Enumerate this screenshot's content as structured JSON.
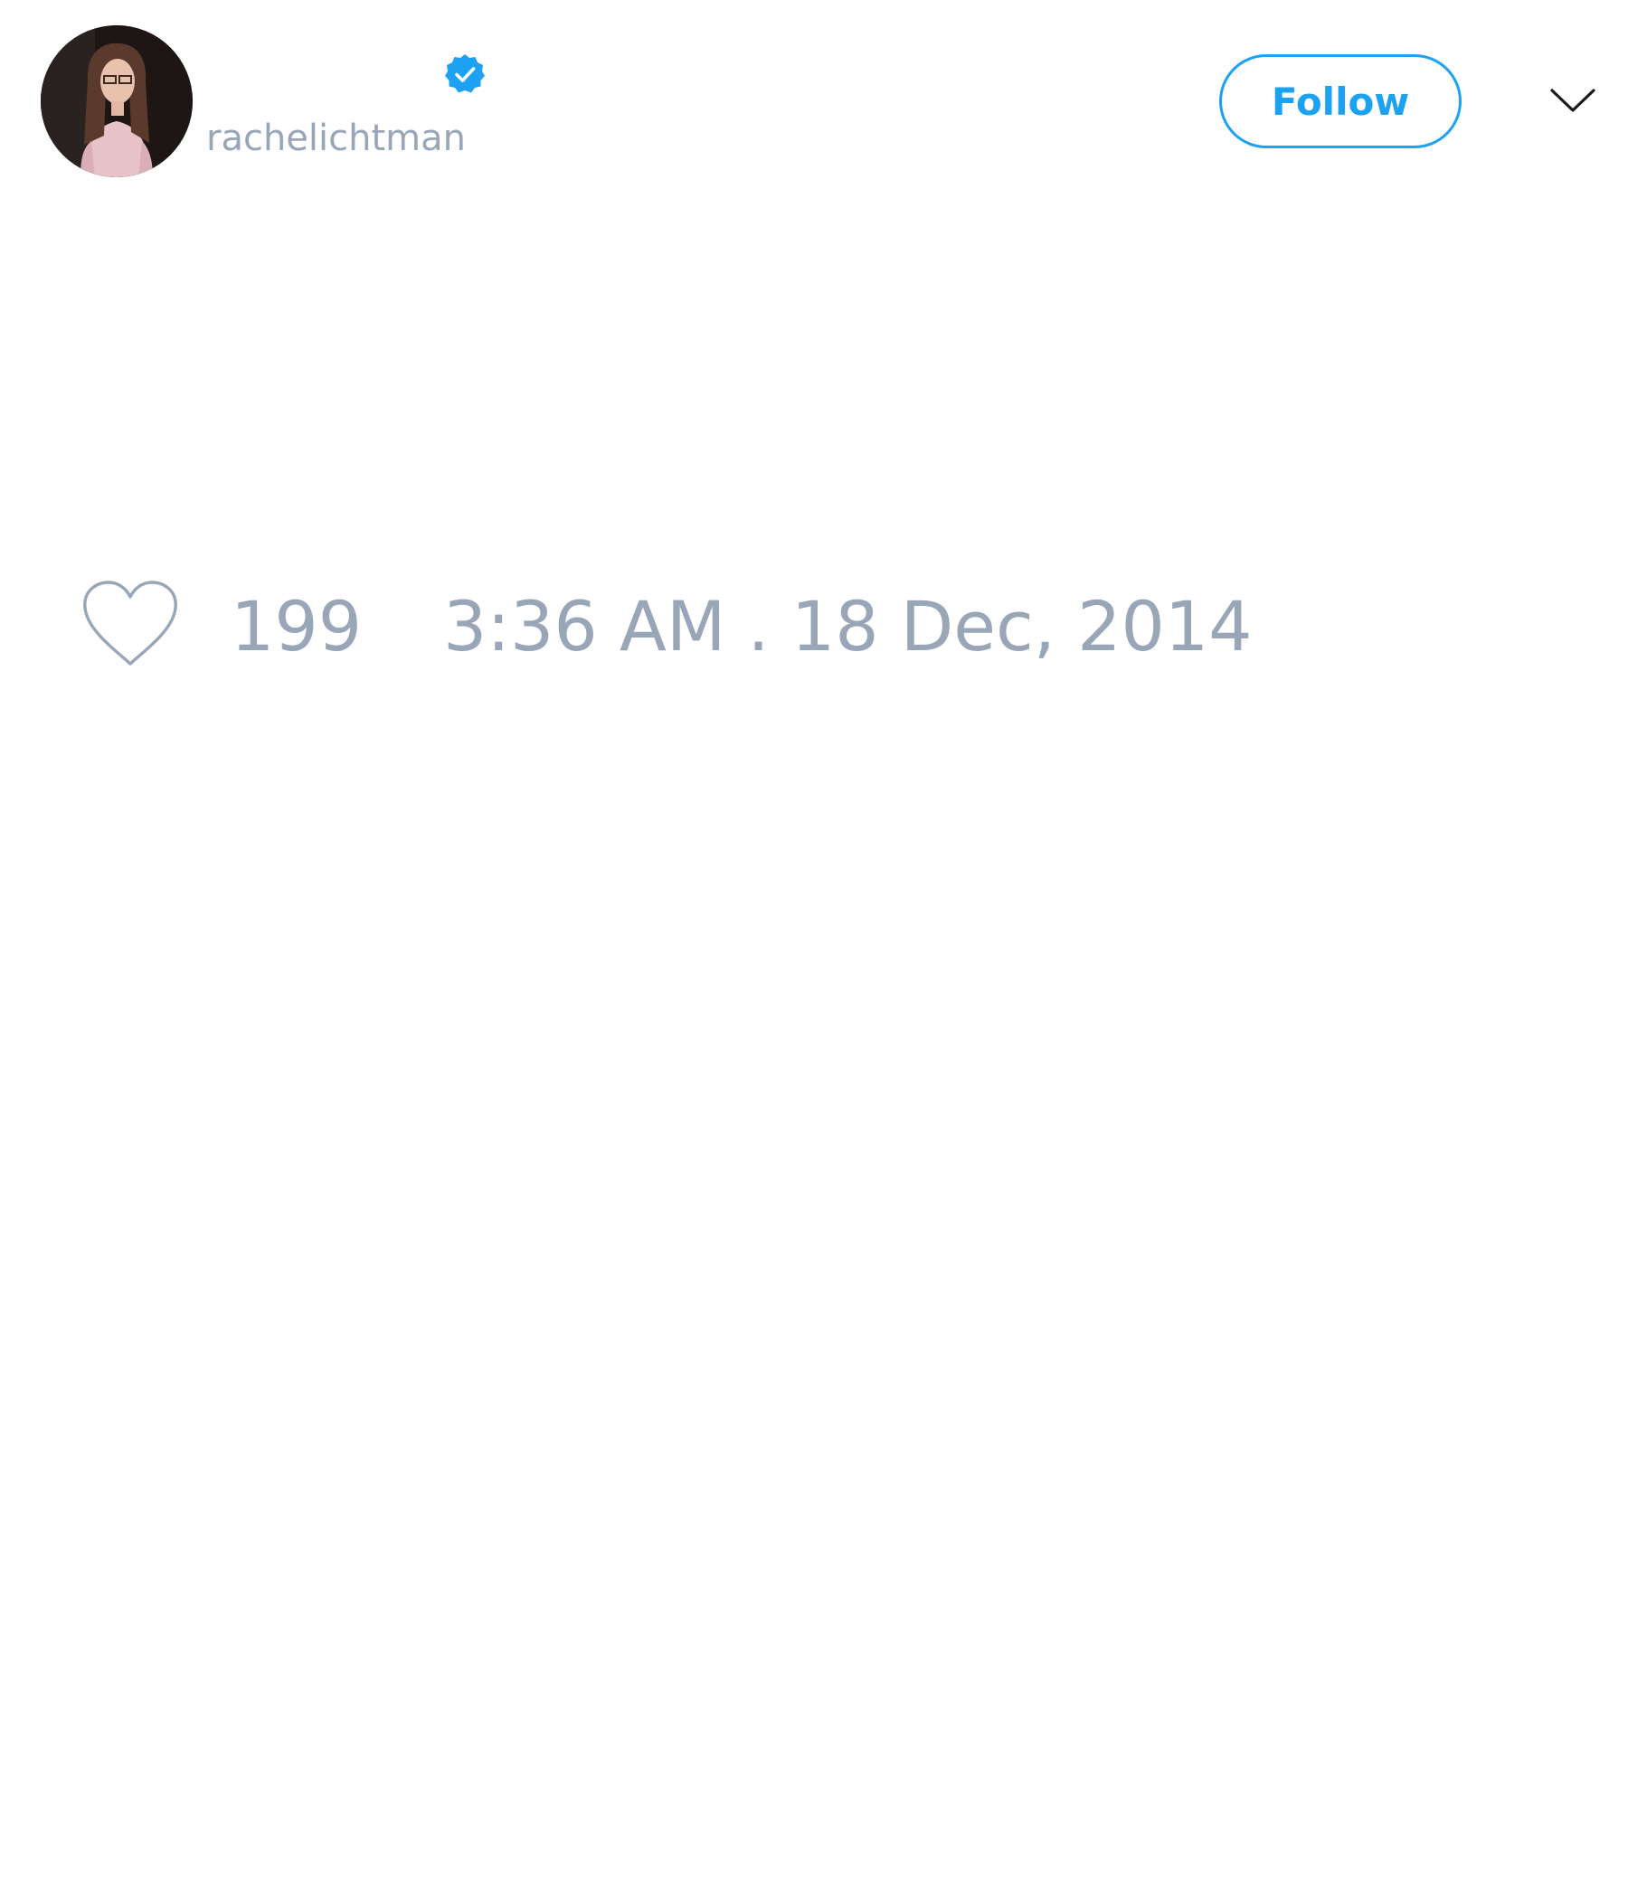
{
  "author": {
    "username": "rachelichtman",
    "verified": true
  },
  "header": {
    "follow_label": "Follow"
  },
  "stats": {
    "like_count": "199",
    "timestamp": "3:36 AM . 18 Dec, 2014"
  },
  "icons": {
    "verified": "verified-badge-icon",
    "menu": "chevron-down-icon",
    "like": "heart-outline-icon"
  },
  "colors": {
    "accent": "#1da1f2",
    "muted_text": "#98a6b8",
    "background": "#ffffff"
  }
}
